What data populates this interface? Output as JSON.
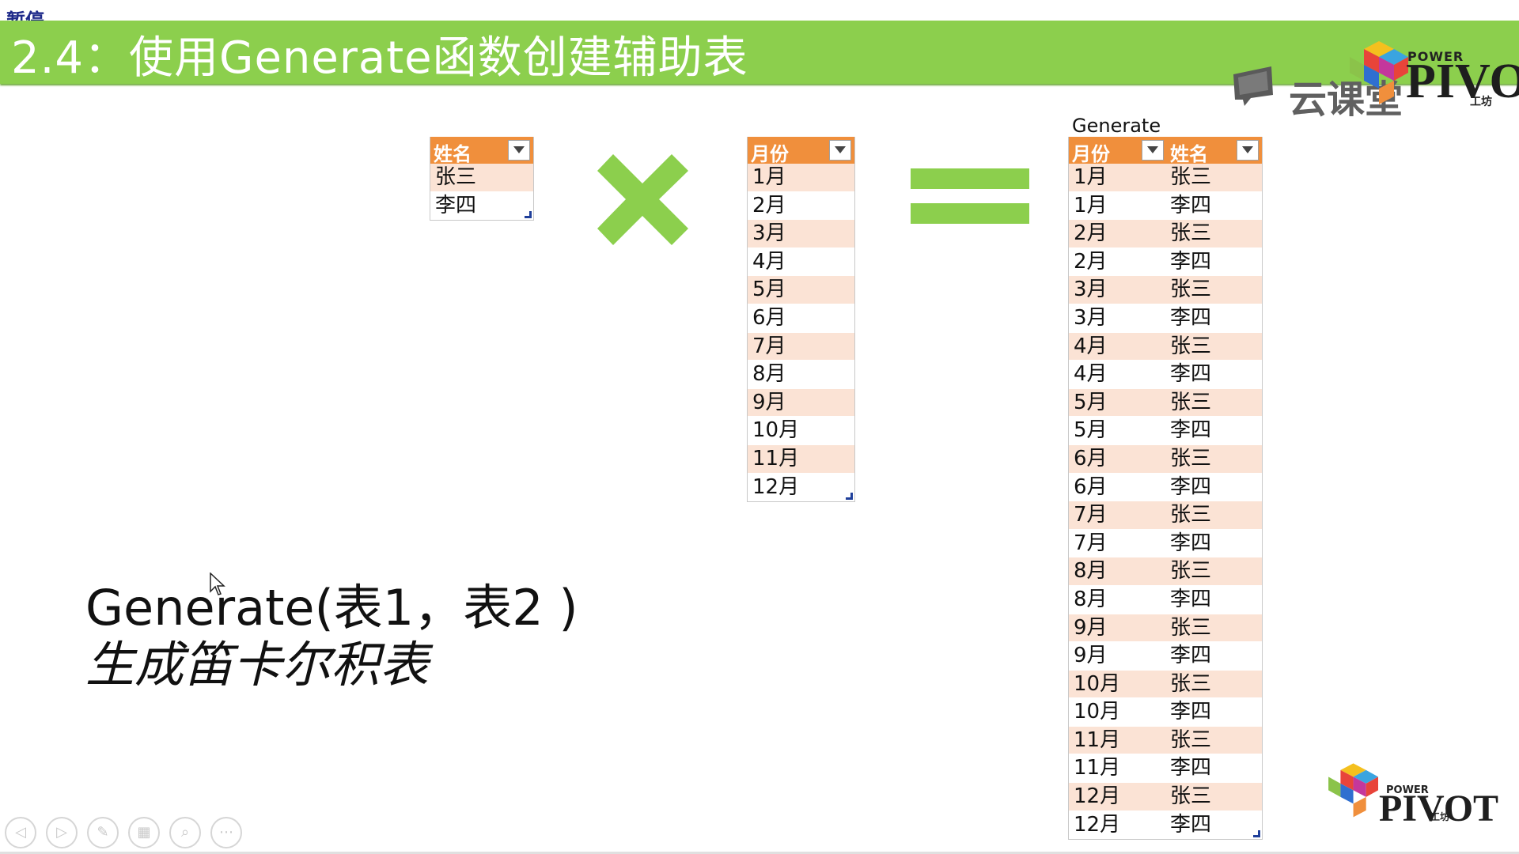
{
  "status_label": "暂停",
  "title": "2.4：使用Generate函数创建辅助表",
  "brand": {
    "yun_text": "云课堂",
    "power": "POWER",
    "pivot": "PIVOT",
    "gongfang": "工坊"
  },
  "table_names": {
    "header": "姓名",
    "rows": [
      "张三",
      "李四"
    ]
  },
  "table_months": {
    "header": "月份",
    "rows": [
      "1月",
      "2月",
      "3月",
      "4月",
      "5月",
      "6月",
      "7月",
      "8月",
      "9月",
      "10月",
      "11月",
      "12月"
    ]
  },
  "generate_label": "Generate",
  "table_generate": {
    "headers": [
      "月份",
      "姓名"
    ],
    "rows": [
      [
        "1月",
        "张三"
      ],
      [
        "1月",
        "李四"
      ],
      [
        "2月",
        "张三"
      ],
      [
        "2月",
        "李四"
      ],
      [
        "3月",
        "张三"
      ],
      [
        "3月",
        "李四"
      ],
      [
        "4月",
        "张三"
      ],
      [
        "4月",
        "李四"
      ],
      [
        "5月",
        "张三"
      ],
      [
        "5月",
        "李四"
      ],
      [
        "6月",
        "张三"
      ],
      [
        "6月",
        "李四"
      ],
      [
        "7月",
        "张三"
      ],
      [
        "7月",
        "李四"
      ],
      [
        "8月",
        "张三"
      ],
      [
        "8月",
        "李四"
      ],
      [
        "9月",
        "张三"
      ],
      [
        "9月",
        "李四"
      ],
      [
        "10月",
        "张三"
      ],
      [
        "10月",
        "李四"
      ],
      [
        "11月",
        "张三"
      ],
      [
        "11月",
        "李四"
      ],
      [
        "12月",
        "张三"
      ],
      [
        "12月",
        "李四"
      ]
    ]
  },
  "formula": "Generate(表1，表2 )",
  "description": "生成笛卡尔积表",
  "controls": [
    "previous-icon",
    "next-icon",
    "pen-icon",
    "slides-icon",
    "zoom-icon",
    "more-icon"
  ],
  "colors": {
    "title_bar": "#8ccf4d",
    "header": "#f08f3c",
    "band": "#fbe3d5"
  }
}
